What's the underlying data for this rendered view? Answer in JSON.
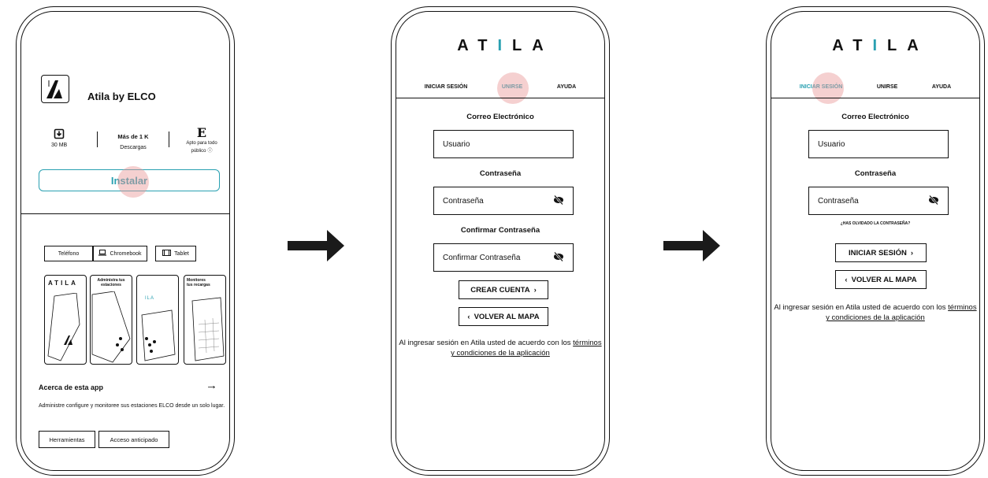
{
  "store": {
    "app_name": "Atila by ELCO",
    "size": "30 MB",
    "downloads_value": "Más de 1 K",
    "downloads_label": "Descargas",
    "rating_badge": "E",
    "rating_label": "Apto para todo público",
    "install_label": "Instalar",
    "device_tabs": [
      "Teléfono",
      "Chromebook",
      "Tablet"
    ],
    "screenshots": [
      "ATILA",
      "Administra tus estaciones",
      "ILA",
      "Monitores tus recargas"
    ],
    "about_title": "Acerca de esta app",
    "about_description": "Administre configure y monitoree sus estaciones ELCO desde un solo lugar.",
    "tags": [
      "Herramientas",
      "Acceso anticipado"
    ]
  },
  "brand": {
    "logo_left": "AT",
    "logo_i": "I",
    "logo_right": "LA",
    "accent": "#29a0b1"
  },
  "signup": {
    "tabs": [
      "INICIAR SESIÓN",
      "UNIRSE",
      "AYUDA"
    ],
    "email_label": "Correo Electrónico",
    "email_placeholder": "Usuario",
    "password_label": "Contraseña",
    "password_placeholder": "Contraseña",
    "confirm_label": "Confirmar Contraseña",
    "confirm_placeholder": "Confirmar Contraseña",
    "create_button": "CREAR CUENTA",
    "back_button": "VOLVER AL MAPA",
    "terms_prefix": "Al ingresar sesión en Atila usted de acuerdo con los ",
    "terms_link": "términos y condiciones de la aplicación"
  },
  "login": {
    "tabs": [
      "INICIAR SESIÓN",
      "UNIRSE",
      "AYUDA"
    ],
    "email_label": "Correo Electrónico",
    "email_placeholder": "Usuario",
    "password_label": "Contraseña",
    "password_placeholder": "Contraseña",
    "forgot_link": "¿HAS OLVIDADO LA CONTRASEÑA?",
    "login_button": "INICIAR SESIÓN",
    "back_button": "VOLVER AL MAPA",
    "terms_prefix": "Al ingresar sesión en Atila usted de acuerdo con los ",
    "terms_link": "términos y condiciones de la aplicación"
  }
}
